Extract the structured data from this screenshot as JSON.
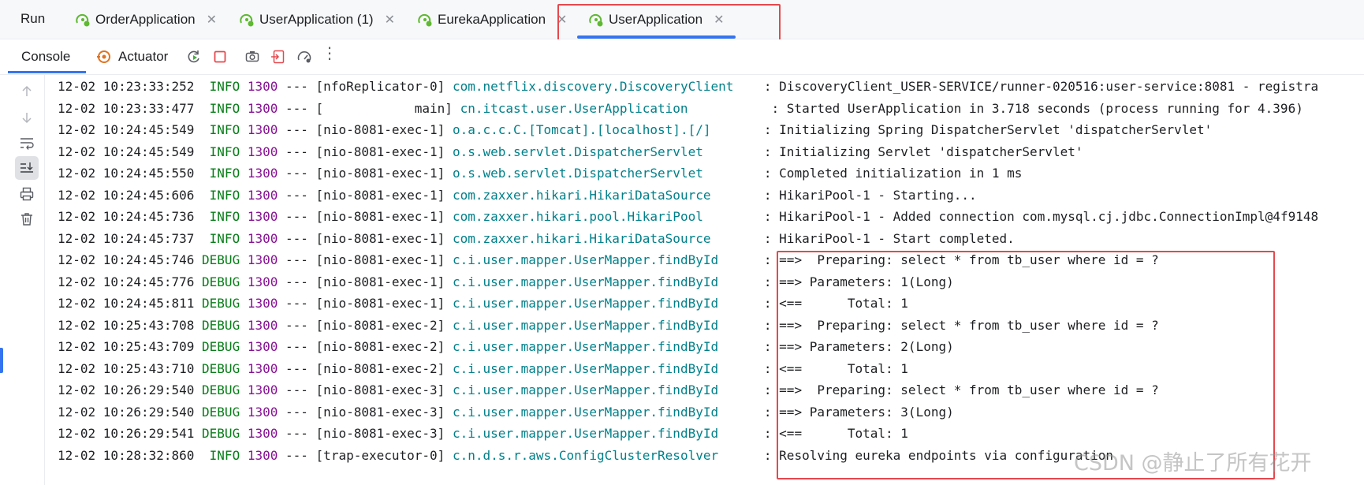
{
  "run_panel": {
    "title": "Run",
    "tabs": [
      {
        "label": "OrderApplication",
        "active": false
      },
      {
        "label": "UserApplication (1)",
        "active": false
      },
      {
        "label": "EurekaApplication",
        "active": false
      },
      {
        "label": "UserApplication",
        "active": true
      }
    ]
  },
  "toolbar": {
    "console_label": "Console",
    "actuator_label": "Actuator",
    "icons": [
      "rerun-icon",
      "stop-icon",
      "screenshot-icon",
      "restore-layout-icon",
      "profiler-icon",
      "more-options-icon"
    ]
  },
  "gutter": {
    "icons": [
      "arrow-up-icon",
      "arrow-down-icon",
      "soft-wrap-icon",
      "scroll-to-end-icon",
      "print-icon",
      "clear-all-icon"
    ]
  },
  "colors": {
    "accent": "#3574f0",
    "highlight_box": "#e5484d",
    "level": "#067d17",
    "pid": "#871094",
    "logger": "#00808a"
  },
  "log_lines": [
    {
      "ts": "12-02 10:23:33:252",
      "level": " INFO",
      "pid": "1300",
      "thread": "[nfoReplicator-0]",
      "logger": "com.netflix.discovery.DiscoveryClient   ",
      "msg": ": DiscoveryClient_USER-SERVICE/runner-020516:user-service:8081 - registra"
    },
    {
      "ts": "12-02 10:23:33:477",
      "level": " INFO",
      "pid": "1300",
      "thread": "[            main]",
      "logger": "cn.itcast.user.UserApplication          ",
      "msg": ": Started UserApplication in 3.718 seconds (process running for 4.396)"
    },
    {
      "ts": "12-02 10:24:45:549",
      "level": " INFO",
      "pid": "1300",
      "thread": "[nio-8081-exec-1]",
      "logger": "o.a.c.c.C.[Tomcat].[localhost].[/]      ",
      "msg": ": Initializing Spring DispatcherServlet 'dispatcherServlet'"
    },
    {
      "ts": "12-02 10:24:45:549",
      "level": " INFO",
      "pid": "1300",
      "thread": "[nio-8081-exec-1]",
      "logger": "o.s.web.servlet.DispatcherServlet       ",
      "msg": ": Initializing Servlet 'dispatcherServlet'"
    },
    {
      "ts": "12-02 10:24:45:550",
      "level": " INFO",
      "pid": "1300",
      "thread": "[nio-8081-exec-1]",
      "logger": "o.s.web.servlet.DispatcherServlet       ",
      "msg": ": Completed initialization in 1 ms"
    },
    {
      "ts": "12-02 10:24:45:606",
      "level": " INFO",
      "pid": "1300",
      "thread": "[nio-8081-exec-1]",
      "logger": "com.zaxxer.hikari.HikariDataSource      ",
      "msg": ": HikariPool-1 - Starting..."
    },
    {
      "ts": "12-02 10:24:45:736",
      "level": " INFO",
      "pid": "1300",
      "thread": "[nio-8081-exec-1]",
      "logger": "com.zaxxer.hikari.pool.HikariPool       ",
      "msg": ": HikariPool-1 - Added connection com.mysql.cj.jdbc.ConnectionImpl@4f9148"
    },
    {
      "ts": "12-02 10:24:45:737",
      "level": " INFO",
      "pid": "1300",
      "thread": "[nio-8081-exec-1]",
      "logger": "com.zaxxer.hikari.HikariDataSource      ",
      "msg": ": HikariPool-1 - Start completed."
    },
    {
      "ts": "12-02 10:24:45:746",
      "level": "DEBUG",
      "pid": "1300",
      "thread": "[nio-8081-exec-1]",
      "logger": "c.i.user.mapper.UserMapper.findById     ",
      "msg": ": ==>  Preparing: select * from tb_user where id = ?"
    },
    {
      "ts": "12-02 10:24:45:776",
      "level": "DEBUG",
      "pid": "1300",
      "thread": "[nio-8081-exec-1]",
      "logger": "c.i.user.mapper.UserMapper.findById     ",
      "msg": ": ==> Parameters: 1(Long)"
    },
    {
      "ts": "12-02 10:24:45:811",
      "level": "DEBUG",
      "pid": "1300",
      "thread": "[nio-8081-exec-1]",
      "logger": "c.i.user.mapper.UserMapper.findById     ",
      "msg": ": <==      Total: 1"
    },
    {
      "ts": "12-02 10:25:43:708",
      "level": "DEBUG",
      "pid": "1300",
      "thread": "[nio-8081-exec-2]",
      "logger": "c.i.user.mapper.UserMapper.findById     ",
      "msg": ": ==>  Preparing: select * from tb_user where id = ?"
    },
    {
      "ts": "12-02 10:25:43:709",
      "level": "DEBUG",
      "pid": "1300",
      "thread": "[nio-8081-exec-2]",
      "logger": "c.i.user.mapper.UserMapper.findById     ",
      "msg": ": ==> Parameters: 2(Long)"
    },
    {
      "ts": "12-02 10:25:43:710",
      "level": "DEBUG",
      "pid": "1300",
      "thread": "[nio-8081-exec-2]",
      "logger": "c.i.user.mapper.UserMapper.findById     ",
      "msg": ": <==      Total: 1"
    },
    {
      "ts": "12-02 10:26:29:540",
      "level": "DEBUG",
      "pid": "1300",
      "thread": "[nio-8081-exec-3]",
      "logger": "c.i.user.mapper.UserMapper.findById     ",
      "msg": ": ==>  Preparing: select * from tb_user where id = ?"
    },
    {
      "ts": "12-02 10:26:29:540",
      "level": "DEBUG",
      "pid": "1300",
      "thread": "[nio-8081-exec-3]",
      "logger": "c.i.user.mapper.UserMapper.findById     ",
      "msg": ": ==> Parameters: 3(Long)"
    },
    {
      "ts": "12-02 10:26:29:541",
      "level": "DEBUG",
      "pid": "1300",
      "thread": "[nio-8081-exec-3]",
      "logger": "c.i.user.mapper.UserMapper.findById     ",
      "msg": ": <==      Total: 1"
    },
    {
      "ts": "12-02 10:28:32:860",
      "level": " INFO",
      "pid": "1300",
      "thread": "[trap-executor-0]",
      "logger": "c.n.d.s.r.aws.ConfigClusterResolver     ",
      "msg": ": Resolving eureka endpoints via configuration"
    }
  ],
  "watermark": "CSDN @静止了所有花开"
}
